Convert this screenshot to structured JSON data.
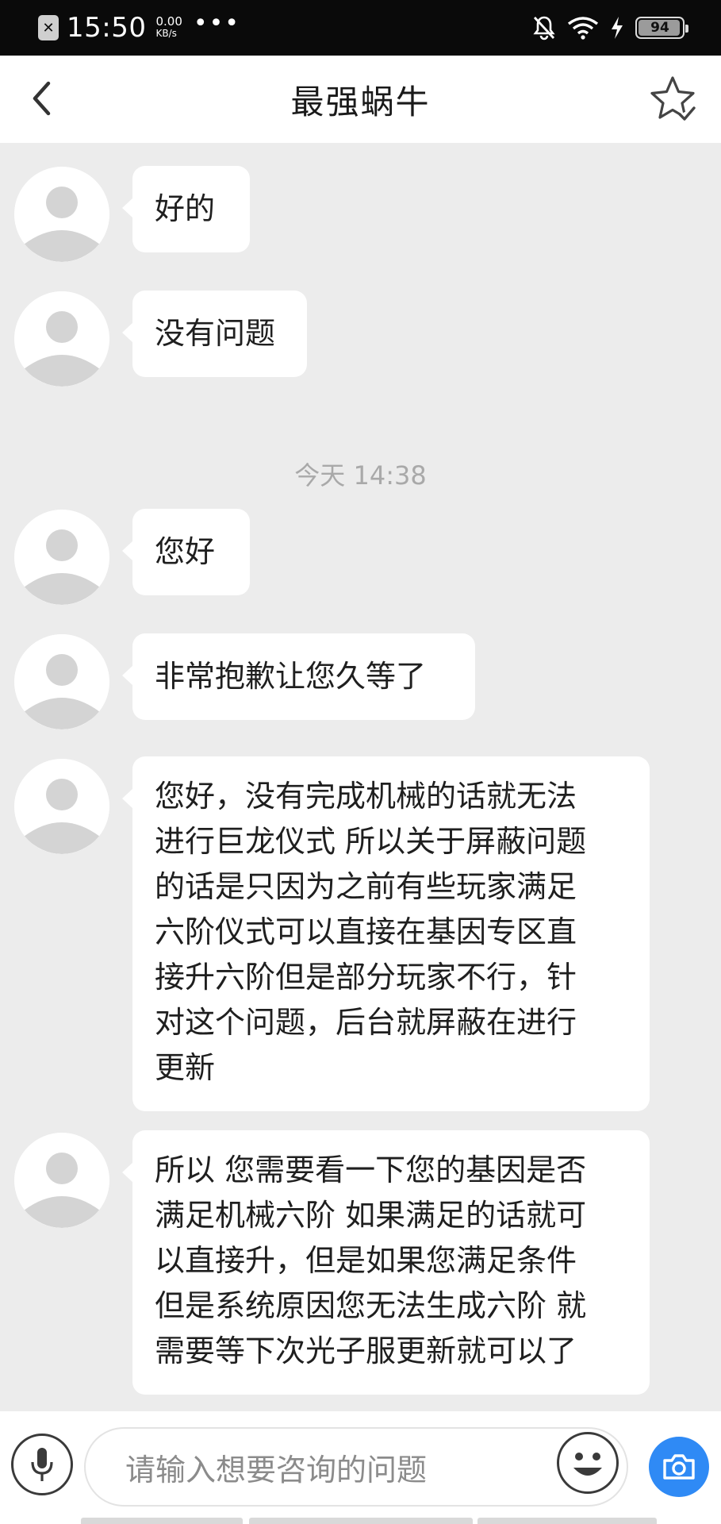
{
  "status_bar": {
    "time": "15:50",
    "speed_value": "0.00",
    "speed_unit": "KB/s",
    "more": "•••",
    "battery": "94",
    "icons": [
      "sim-error-icon",
      "mute-bell-icon",
      "wifi-icon",
      "charging-icon",
      "battery-icon"
    ]
  },
  "header": {
    "back_icon": "chevron-left-icon",
    "title": "最强蜗牛",
    "favorite_icon": "star-check-icon"
  },
  "conversation": {
    "messages_before": [
      {
        "text": "好的"
      },
      {
        "text": "没有问题"
      }
    ],
    "timestamp": "今天 14:38",
    "messages_after": [
      {
        "text": "您好"
      },
      {
        "text": "非常抱歉让您久等了"
      },
      {
        "lines": [
          "您好，没有完成机械的话就无法",
          "进行巨龙仪式 所以关于屏蔽问题",
          "的话是只因为之前有些玩家满足",
          "六阶仪式可以直接在基因专区直",
          "接升六阶但是部分玩家不行，针",
          "对这个问题，后台就屏蔽在进行",
          "更新"
        ]
      },
      {
        "lines": [
          "所以 您需要看一下您的基因是否",
          "满足机械六阶 如果满足的话就可",
          "以直接升，但是如果您满足条件",
          "但是系统原因您无法生成六阶 就",
          "需要等下次光子服更新就可以了"
        ]
      }
    ]
  },
  "input_bar": {
    "placeholder": "请输入想要咨询的问题",
    "mic_icon": "microphone-icon",
    "emoji_icon": "emoji-icon",
    "camera_icon": "camera-icon",
    "accent_color": "#2f8af5"
  }
}
